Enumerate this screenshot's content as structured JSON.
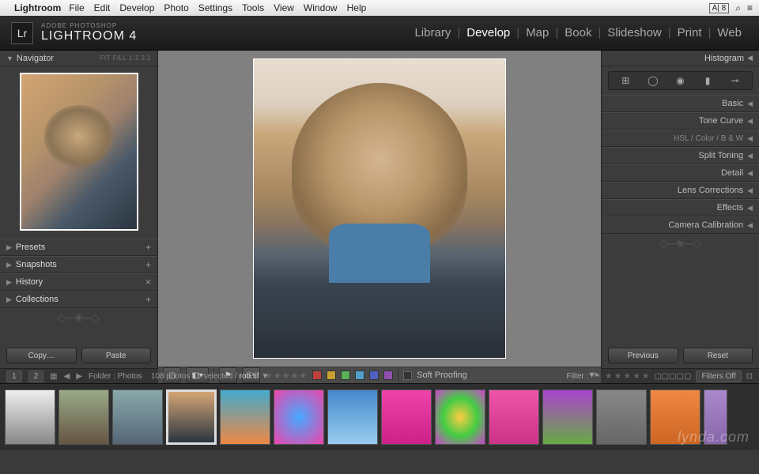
{
  "mac_menu": {
    "app": "Lightroom",
    "items": [
      "File",
      "Edit",
      "Develop",
      "Photo",
      "Settings",
      "Tools",
      "View",
      "Window",
      "Help"
    ]
  },
  "brand": {
    "sub": "ADOBE PHOTOSHOP",
    "main": "LIGHTROOM 4",
    "logo": "Lr"
  },
  "modules": [
    "Library",
    "Develop",
    "Map",
    "Book",
    "Slideshow",
    "Print",
    "Web"
  ],
  "active_module": "Develop",
  "left": {
    "navigator": {
      "title": "Navigator",
      "opts": "FIT  FILL  1:1  2:1"
    },
    "rows": [
      {
        "label": "Presets",
        "action": "+"
      },
      {
        "label": "Snapshots",
        "action": "+"
      },
      {
        "label": "History",
        "action": "×"
      },
      {
        "label": "Collections",
        "action": "+"
      }
    ],
    "buttons": {
      "copy": "Copy…",
      "paste": "Paste"
    }
  },
  "right": {
    "histogram": "Histogram",
    "rows": [
      {
        "label": "Basic"
      },
      {
        "label": "Tone Curve"
      },
      {
        "label": "HSL  /  Color  /  B & W",
        "sub": true
      },
      {
        "label": "Split Toning"
      },
      {
        "label": "Detail"
      },
      {
        "label": "Lens Corrections"
      },
      {
        "label": "Effects"
      },
      {
        "label": "Camera Calibration"
      }
    ],
    "buttons": {
      "previous": "Previous",
      "reset": "Reset"
    }
  },
  "toolbar": {
    "soft_proofing": "Soft Proofing",
    "swatches": [
      "#c04040",
      "#c8a030",
      "#58b058",
      "#50a0c8",
      "#5060c0",
      "#9050b0"
    ]
  },
  "status": {
    "views": [
      "1",
      "2"
    ],
    "folder_label": "Folder : Photos",
    "count": "108 photos / 1 selected /",
    "filename": "rob.tif",
    "filter_label": "Filter :",
    "filters_off": "Filters Off"
  },
  "watermark": "lynda.com"
}
